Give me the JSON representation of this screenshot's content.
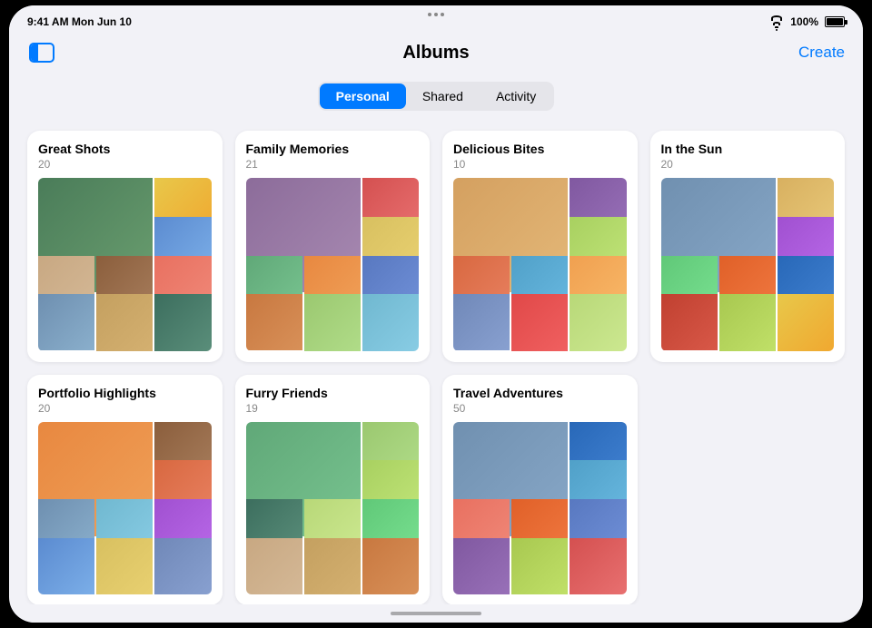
{
  "device": {
    "status_bar": {
      "time": "9:41 AM  Mon Jun 10",
      "battery": "100%",
      "battery_full": true
    },
    "top_dots": [
      "•",
      "•",
      "•"
    ]
  },
  "nav": {
    "title": "Albums",
    "create_label": "Create",
    "sidebar_icon_alt": "sidebar"
  },
  "tabs": {
    "personal": "Personal",
    "shared": "Shared",
    "activity": "Activity",
    "active": "personal"
  },
  "albums": [
    {
      "id": "great-shots",
      "title": "Great Shots",
      "count": "20",
      "photos": [
        "p1",
        "p2",
        "p3",
        "p4",
        "p5",
        "p6",
        "p7",
        "p8",
        "p9"
      ]
    },
    {
      "id": "family-memories",
      "title": "Family Memories",
      "count": "21",
      "photos": [
        "p10",
        "p11",
        "p12",
        "p13",
        "p14",
        "p15",
        "p16",
        "p17",
        "p18"
      ]
    },
    {
      "id": "delicious-bites",
      "title": "Delicious Bites",
      "count": "10",
      "photos": [
        "p19",
        "p20",
        "p21",
        "p22",
        "p23",
        "p24",
        "p25",
        "p26",
        "p27"
      ]
    },
    {
      "id": "in-the-sun",
      "title": "In the Sun",
      "count": "20",
      "photos": [
        "p28",
        "p29",
        "p30",
        "p31",
        "p32",
        "p33",
        "p34",
        "p35",
        "p2"
      ]
    },
    {
      "id": "portfolio-highlights",
      "title": "Portfolio Highlights",
      "count": "20",
      "photos": [
        "p14",
        "p5",
        "p22",
        "p7",
        "p18",
        "p30",
        "p3",
        "p12",
        "p25"
      ]
    },
    {
      "id": "furry-friends",
      "title": "Furry Friends",
      "count": "19",
      "photos": [
        "p13",
        "p17",
        "p21",
        "p9",
        "p27",
        "p31",
        "p4",
        "p8",
        "p16"
      ]
    },
    {
      "id": "travel-adventures",
      "title": "Travel Adventures",
      "count": "50",
      "photos": [
        "p28",
        "p33",
        "p23",
        "p6",
        "p32",
        "p15",
        "p20",
        "p35",
        "p11"
      ]
    }
  ]
}
